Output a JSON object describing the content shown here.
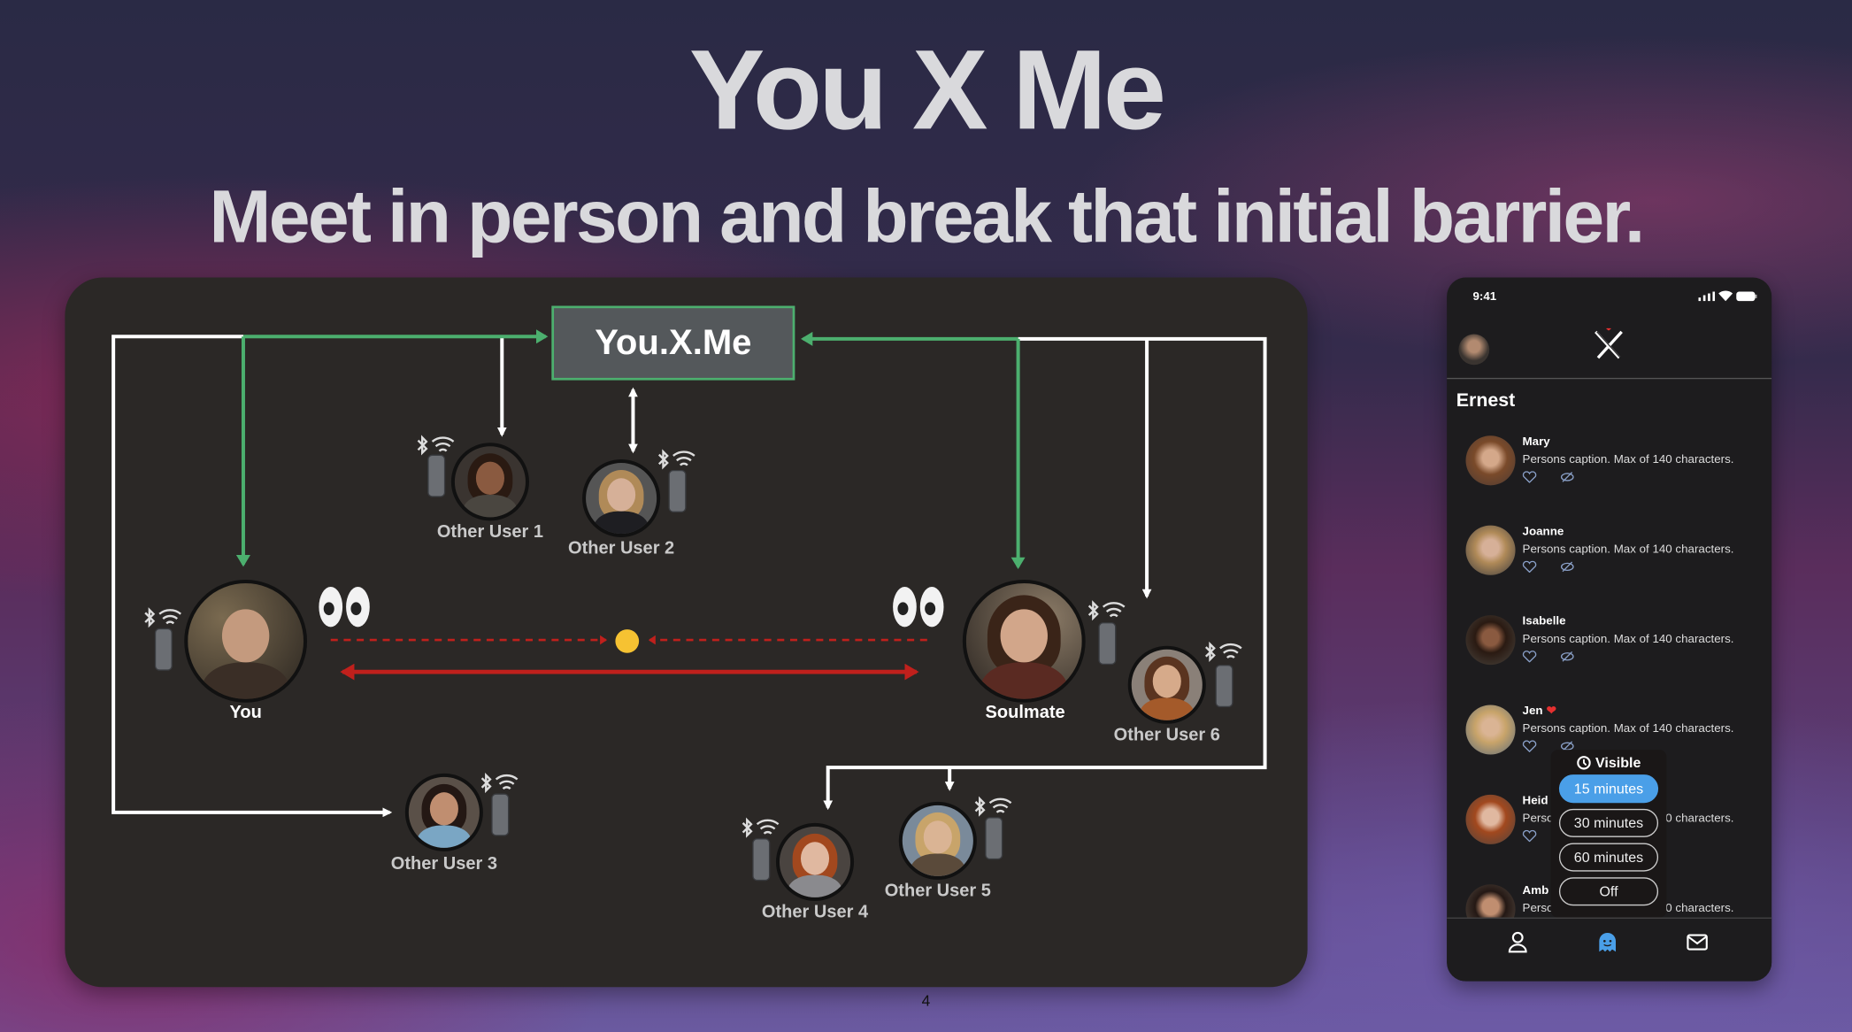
{
  "slide": {
    "title": "You X Me",
    "subtitle": "Meet in person and break that initial barrier.",
    "page_number": "4"
  },
  "diagram": {
    "hub": "You.X.Me",
    "nodes": {
      "you": "You",
      "soulmate": "Soulmate",
      "user1": "Other User 1",
      "user2": "Other User 2",
      "user3": "Other User 3",
      "user4": "Other User 4",
      "user5": "Other User 5",
      "user6": "Other User 6"
    },
    "colors": {
      "green": "#4caf6e",
      "red": "#c0201c",
      "white": "#ffffff"
    }
  },
  "phone": {
    "time": "9:41",
    "user_name": "Ernest",
    "people": [
      {
        "name": "Mary",
        "caption": "Persons caption. Max of 140 characters.",
        "liked": false
      },
      {
        "name": "Joanne",
        "caption": "Persons caption. Max of 140 characters.",
        "liked": false
      },
      {
        "name": "Isabelle",
        "caption": "Persons caption. Max of 140 characters.",
        "liked": false
      },
      {
        "name": "Jen",
        "caption": "Persons caption. Max of 140 characters.",
        "liked": true
      },
      {
        "name": "Heid",
        "caption": "Persons caption. Max of 140 characters.",
        "liked": false
      },
      {
        "name": "Amb",
        "caption": "Persons caption. Max of 140 characters.",
        "liked": false
      }
    ],
    "visibility_popup": {
      "title": "Visible",
      "options": [
        "15 minutes",
        "30 minutes",
        "60 minutes",
        "Off"
      ],
      "selected": "15 minutes"
    },
    "tabs": [
      "profile-icon",
      "ghost-icon",
      "mail-icon"
    ],
    "accent": "#4a9fe8"
  }
}
